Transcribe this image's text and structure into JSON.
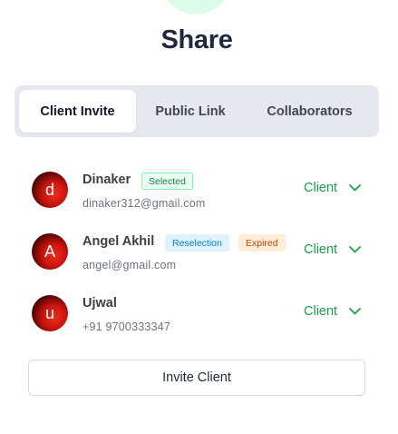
{
  "title": "Share",
  "tabs": [
    {
      "label": "Client Invite",
      "active": true
    },
    {
      "label": "Public Link",
      "active": false
    },
    {
      "label": "Collaborators",
      "active": false
    }
  ],
  "members": [
    {
      "initial": "d",
      "name": "Dinaker",
      "contact": "dinaker312@gmail.com",
      "badges": [
        "Selected"
      ],
      "role": "Client"
    },
    {
      "initial": "A",
      "name": "Angel Akhil",
      "contact": "angel@gmail.com",
      "badges": [
        "Reselection",
        "Expired"
      ],
      "role": "Client"
    },
    {
      "initial": "u",
      "name": "Ujwal",
      "contact": "+91 9700333347",
      "badges": [],
      "role": "Client"
    }
  ],
  "invite_button": "Invite Client",
  "colors": {
    "accent_green": "#16a34a",
    "title": "#1e293b",
    "tab_bg": "#e5e9ef",
    "badge_selected": "#15803d",
    "badge_reselection": "#0284c7",
    "badge_expired": "#c2410c"
  },
  "icons": {
    "role_dropdown": "chevron-down-icon"
  }
}
